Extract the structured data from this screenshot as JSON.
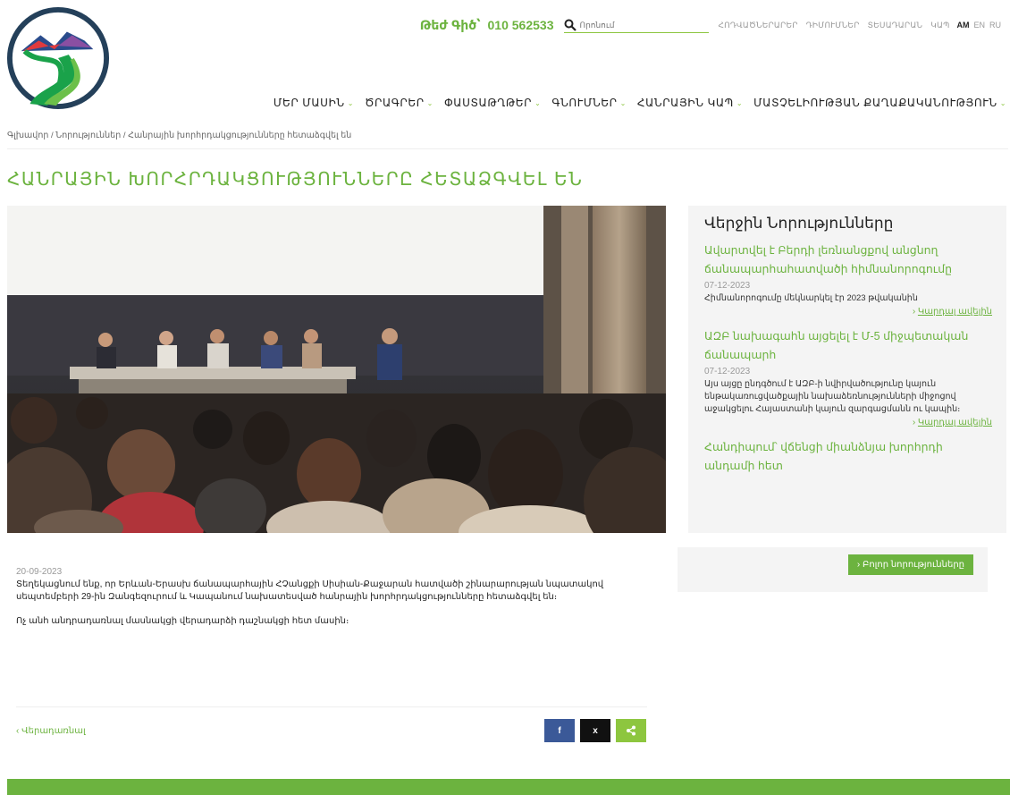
{
  "header": {
    "hotline_label": "Թեժ Գիծ՝",
    "hotline_number": "010 562533",
    "search_placeholder": "Որոնում",
    "top_links": [
      "ՀՈԴՎԱԾՆԵՐԱՐԵՐ",
      "ԴԻՄՈՒՄՆԵՐ",
      "ՏԵՍԱԴԱՐԱՆ",
      "ԿԱՊ"
    ],
    "languages": [
      "AM",
      "EN",
      "RU"
    ],
    "active_language": "AM"
  },
  "nav": {
    "items": [
      "ՄԵՐ ՄԱՍԻՆ",
      "ԾՐԱԳՐԵՐ",
      "ՓԱՍՏԱԹՂԹԵՐ",
      "ԳՆՈՒՄՆԵՐ",
      "ՀԱՆՐԱՅԻՆ ԿԱՊ",
      "ՄԱՏՉԵԼԻՈՒԹՅԱՆ ՔԱՂԱՔԱԿԱՆՈՒԹՅՈՒՆ"
    ]
  },
  "breadcrumb": "Գլխավոր / Նորություններ / Հանրային խորհրդակցությունները հետաձգվել են",
  "page_title": "ՀԱՆՐԱՅԻՆ ԽՈՐՀՐԴԱԿՑՈՒԹՅՈՒՆՆԵՐԸ ՀԵՏԱՁԳՎԵԼ ԵՆ",
  "sidebar": {
    "title": "Վերջին Նորությունները",
    "news": [
      {
        "title": "Ավարտվել է Բերդի լեռնանցքով անցնող ճանապարհահատվածի հիմնանորոգումը",
        "date": "07-12-2023",
        "text": "Հիմնանորոգումը մեկնարկել էր 2023 թվականին",
        "more": "Կարդալ ավելին"
      },
      {
        "title": "ԱԶԲ նախագահն այցելել է Մ-5 միջպետական ճանապարհ",
        "date": "07-12-2023",
        "text": "Այս այցը ընդգծում է ԱԶԲ-ի նվիրվածությունը կայուն ենթակառուցվածքային նախաձեռնությունների միջոցով աջակցելու Հայաստանի կայուն զարգացմանն ու կապին։",
        "more": "Կարդալ ավելին"
      },
      {
        "title": "Հանդիպում՝ վճենցի միանձնյա խորհրդի անդամի հետ",
        "date": "",
        "text": "",
        "more": ""
      }
    ],
    "all_news_label": "Բոլոր նորությունները"
  },
  "article": {
    "date": "20-09-2023",
    "paragraph1": "Տեղեկացնում ենք, որ Երևան-Երասխ ճանապարհային ՀՉանցքի Սիսիան-Քաջարան հատվածի շինարարության նպատակով սեպտեմբերի 29-ին Զանգեզուրում և Կապանում նախատեսված հանրային խորհրդակցությունները հետաձգվել են։",
    "paragraph2": "Ոչ անհ անդրադառնալ մասնակցի վերադարձի դաշնակցի հետ մասին։",
    "back_label": "Վերադառնալ"
  },
  "share": {
    "fb": "f",
    "x": "x",
    "share": "<"
  },
  "colors": {
    "accent": "#6cb33f",
    "accent_light": "#8dc63f",
    "facebook": "#3b5998"
  }
}
